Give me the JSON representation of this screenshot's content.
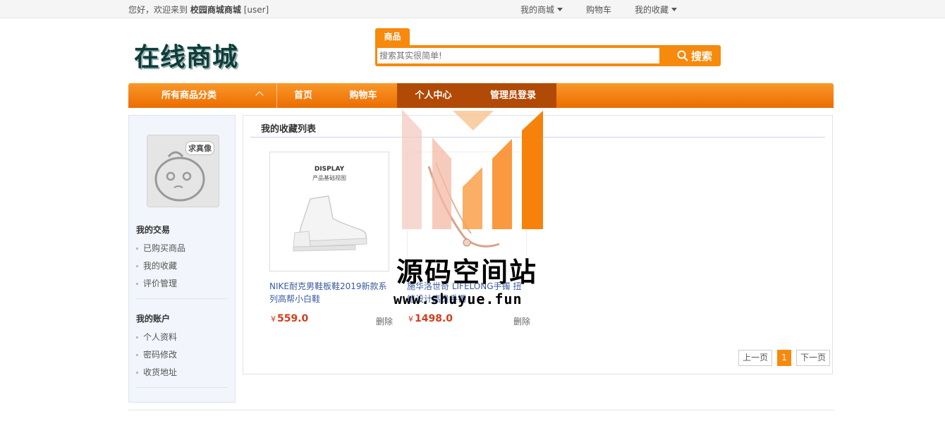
{
  "topbar": {
    "welcome_prefix": "您好，欢迎来到",
    "site_name": "校园商城商城",
    "username": "[user]",
    "links": [
      "我的商城",
      "购物车",
      "我的收藏"
    ]
  },
  "header": {
    "logo_text": "在线商城",
    "search_tab": "商品",
    "search_placeholder": "搜索其实很简单!",
    "search_button": "搜索"
  },
  "nav": {
    "all_categories": "所有商品分类",
    "items": [
      "首页",
      "购物车",
      "个人中心",
      "管理员登录"
    ],
    "active_index": 2
  },
  "sidebar": {
    "avatar_tag": "求真像",
    "sections": [
      {
        "title": "我的交易",
        "items": [
          "已购买商品",
          "我的收藏",
          "评价管理"
        ]
      },
      {
        "title": "我的账户",
        "items": [
          "个人资料",
          "密码修改",
          "收货地址"
        ]
      }
    ]
  },
  "main": {
    "title": "我的收藏列表",
    "products": [
      {
        "name": "NIKE耐克男鞋板鞋2019新款系列高帮小白鞋",
        "currency": "¥",
        "price": "559.0",
        "delete_label": "删除",
        "img_caption_1": "DISPLAY",
        "img_caption_2": "产品基础视图"
      },
      {
        "name": "施华洛世奇 LIFELONG手镯 扭结设计高贵手镯",
        "currency": "¥",
        "price": "1498.0",
        "delete_label": "删除"
      }
    ],
    "pager": {
      "prev": "上一页",
      "current": "1",
      "next": "下一页"
    }
  },
  "watermark": {
    "title": "源码空间站",
    "url": "www.shuyue.fun"
  },
  "colors": {
    "accent": "#f7890d",
    "nav_active": "#b14a06",
    "price": "#d43d1a",
    "link": "#3a5b9f"
  }
}
